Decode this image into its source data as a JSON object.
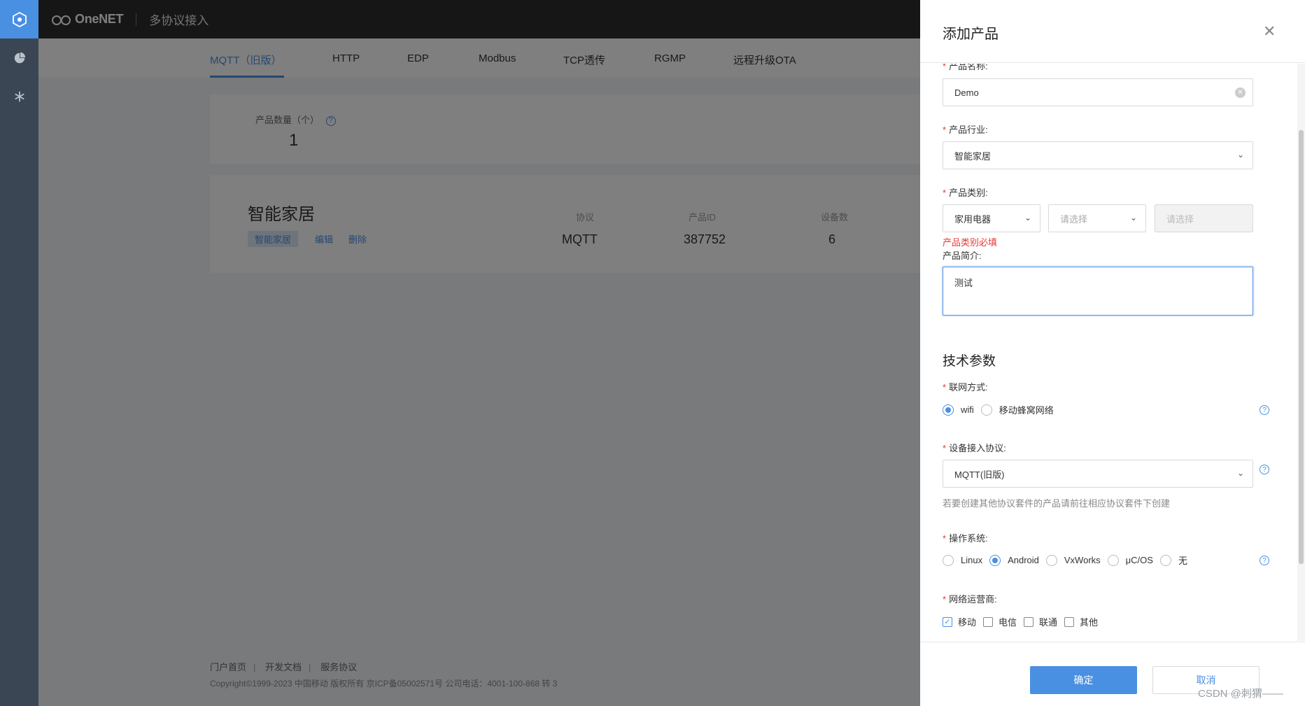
{
  "topbar": {
    "brand": "OneNET",
    "section": "多协议接入"
  },
  "tabs": [
    "MQTT（旧版）",
    "HTTP",
    "EDP",
    "Modbus",
    "TCP透传",
    "RGMP",
    "远程升级OTA"
  ],
  "stats": {
    "count_label": "产品数量（个）",
    "count_value": "1"
  },
  "product": {
    "title": "智能家居",
    "tag": "智能家居",
    "edit": "编辑",
    "delete": "删除",
    "protocol_label": "协议",
    "protocol_value": "MQTT",
    "id_label": "产品ID",
    "id_value": "387752",
    "devices_label": "设备数",
    "devices_value": "6"
  },
  "footer": {
    "links": [
      "门户首页",
      "开发文档",
      "服务协议"
    ],
    "copyright": "Copyright©1999-2023 中国移动 版权所有 京ICP备05002571号 公司电话：4001-100-868 转 3"
  },
  "drawer": {
    "title": "添加产品",
    "product_name_label": "产品名称:",
    "product_name_value": "Demo",
    "industry_label": "产品行业:",
    "industry_value": "智能家居",
    "category_label": "产品类别:",
    "category_1": "家用电器",
    "category_2_placeholder": "请选择",
    "category_3_placeholder": "请选择",
    "category_error": "产品类别必填",
    "intro_label": "产品简介:",
    "intro_value": "测试",
    "tech_title": "技术参数",
    "network_label": "联网方式:",
    "network_options": [
      "wifi",
      "移动蜂窝网络"
    ],
    "protocol_label": "设备接入协议:",
    "protocol_value": "MQTT(旧版)",
    "protocol_hint": "若要创建其他协议套件的产品请前往相应协议套件下创建",
    "os_label": "操作系统:",
    "os_options": [
      "Linux",
      "Android",
      "VxWorks",
      "μC/OS",
      "无"
    ],
    "carrier_label": "网络运营商:",
    "carrier_options": [
      "移动",
      "电信",
      "联通",
      "其他"
    ],
    "confirm": "确定",
    "cancel": "取消"
  },
  "watermark": "CSDN @刺猬——",
  "colors": {
    "accent": "#4a90e2",
    "error": "#e53935",
    "topbar": "#2c2c2c",
    "rail": "#3a4654"
  }
}
